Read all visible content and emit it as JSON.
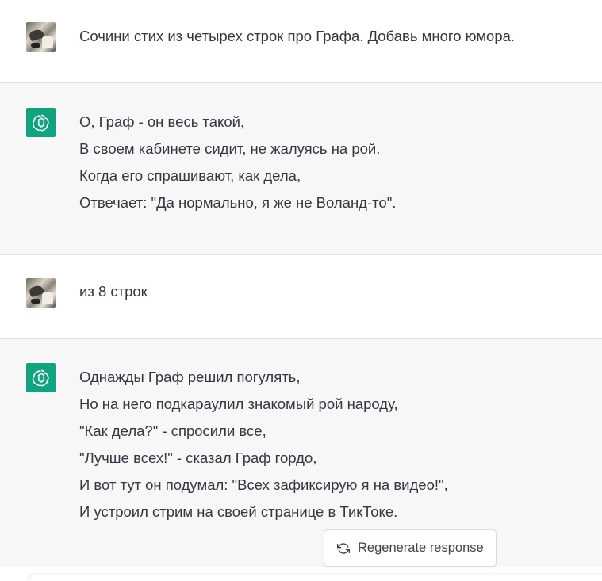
{
  "conversation": [
    {
      "role": "user",
      "avatar": "user-photo-avatar",
      "lines": [
        "Сочини стих из четырех строк про Графа. Добавь много юмора."
      ]
    },
    {
      "role": "assistant",
      "avatar": "openai-logo-icon",
      "lines": [
        "О, Граф - он весь такой,",
        "В своем кабинете сидит, не жалуясь на рой.",
        "Когда его спрашивают, как дела,",
        "Отвечает: \"Да нормально, я же не Воланд-то\"."
      ]
    },
    {
      "role": "user",
      "avatar": "user-photo-avatar",
      "lines": [
        "из 8 строк"
      ]
    },
    {
      "role": "assistant",
      "avatar": "openai-logo-icon",
      "lines": [
        "Однажды Граф решил погулять,",
        "Но на него подкараулил знакомый рой народу,",
        "\"Как дела?\" - спросили все,",
        "\"Лучше всех!\" - сказал Граф гордо,",
        "И вот тут он подумал: \"Всех зафиксирую я на видео!\",",
        "И устроил стрим на своей странице в ТикТоке."
      ]
    }
  ],
  "regenerate": {
    "label": "Regenerate response",
    "icon": "refresh-icon"
  },
  "colors": {
    "assistant_bg": "#f7f7f8",
    "user_bg": "#ffffff",
    "brand": "#10a37f",
    "text": "#353740"
  }
}
